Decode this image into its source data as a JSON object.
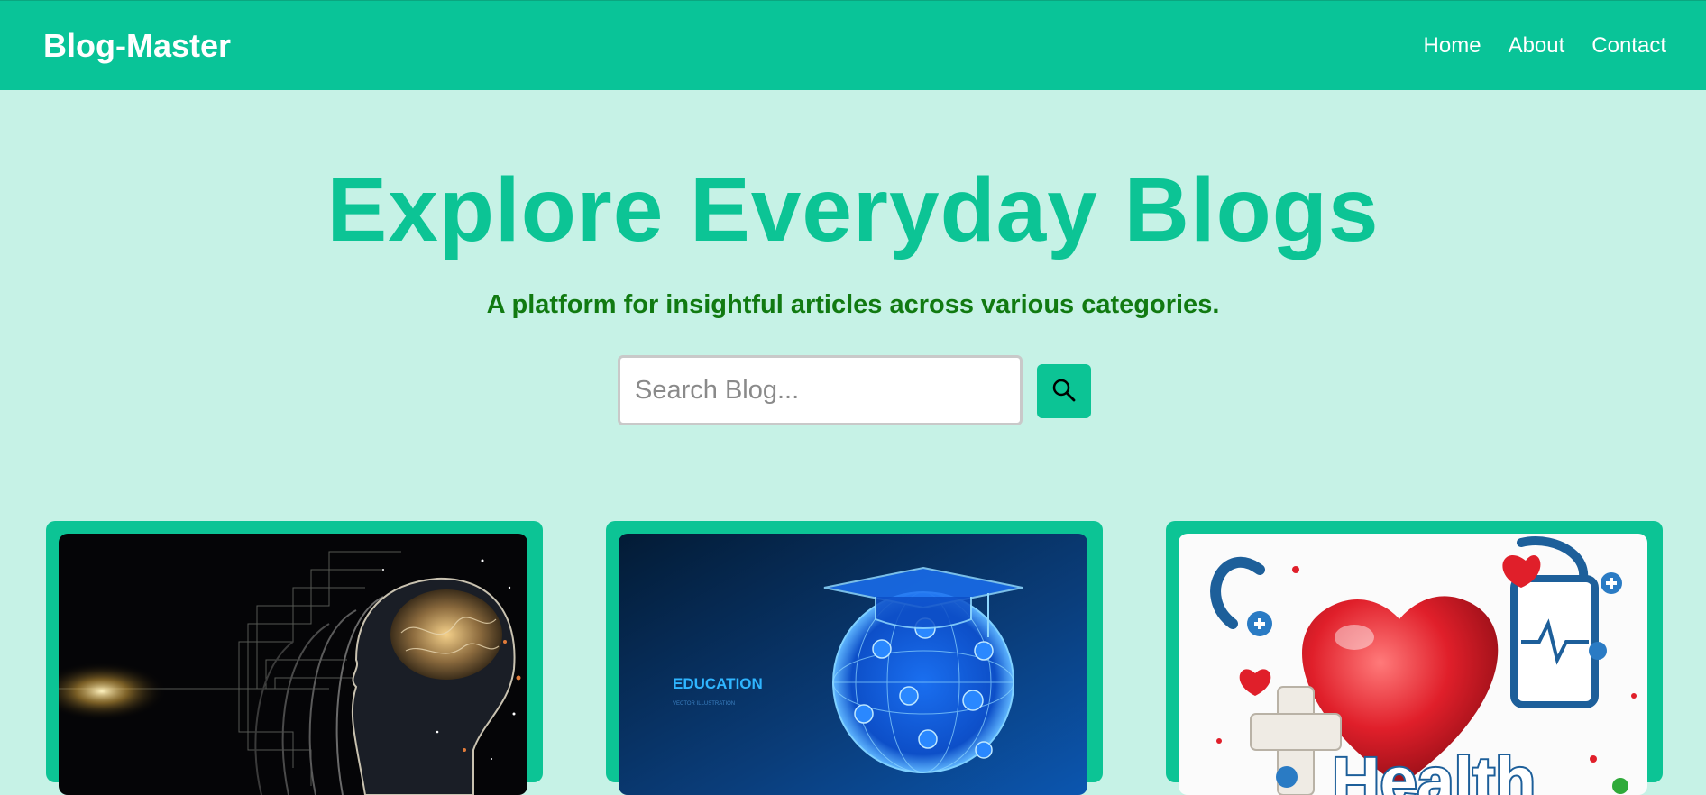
{
  "navbar": {
    "brand": "Blog-Master",
    "links": [
      "Home",
      "About",
      "Contact"
    ]
  },
  "hero": {
    "title": "Explore Everyday Blogs",
    "subtitle": "A platform for insightful articles across various categories."
  },
  "search": {
    "placeholder": "Search Blog...",
    "value": "",
    "button_icon": "search-icon"
  },
  "cards": [
    {
      "image": "ai-brain-image",
      "image_text": ""
    },
    {
      "image": "education-globe-image",
      "image_text": "EDUCATION",
      "image_subtext": "VECTOR ILLUSTRATION"
    },
    {
      "image": "health-heart-image",
      "image_text": "Health"
    }
  ],
  "colors": {
    "primary": "#09c498",
    "background": "#c6f2e6",
    "subtitle": "#117a11"
  }
}
